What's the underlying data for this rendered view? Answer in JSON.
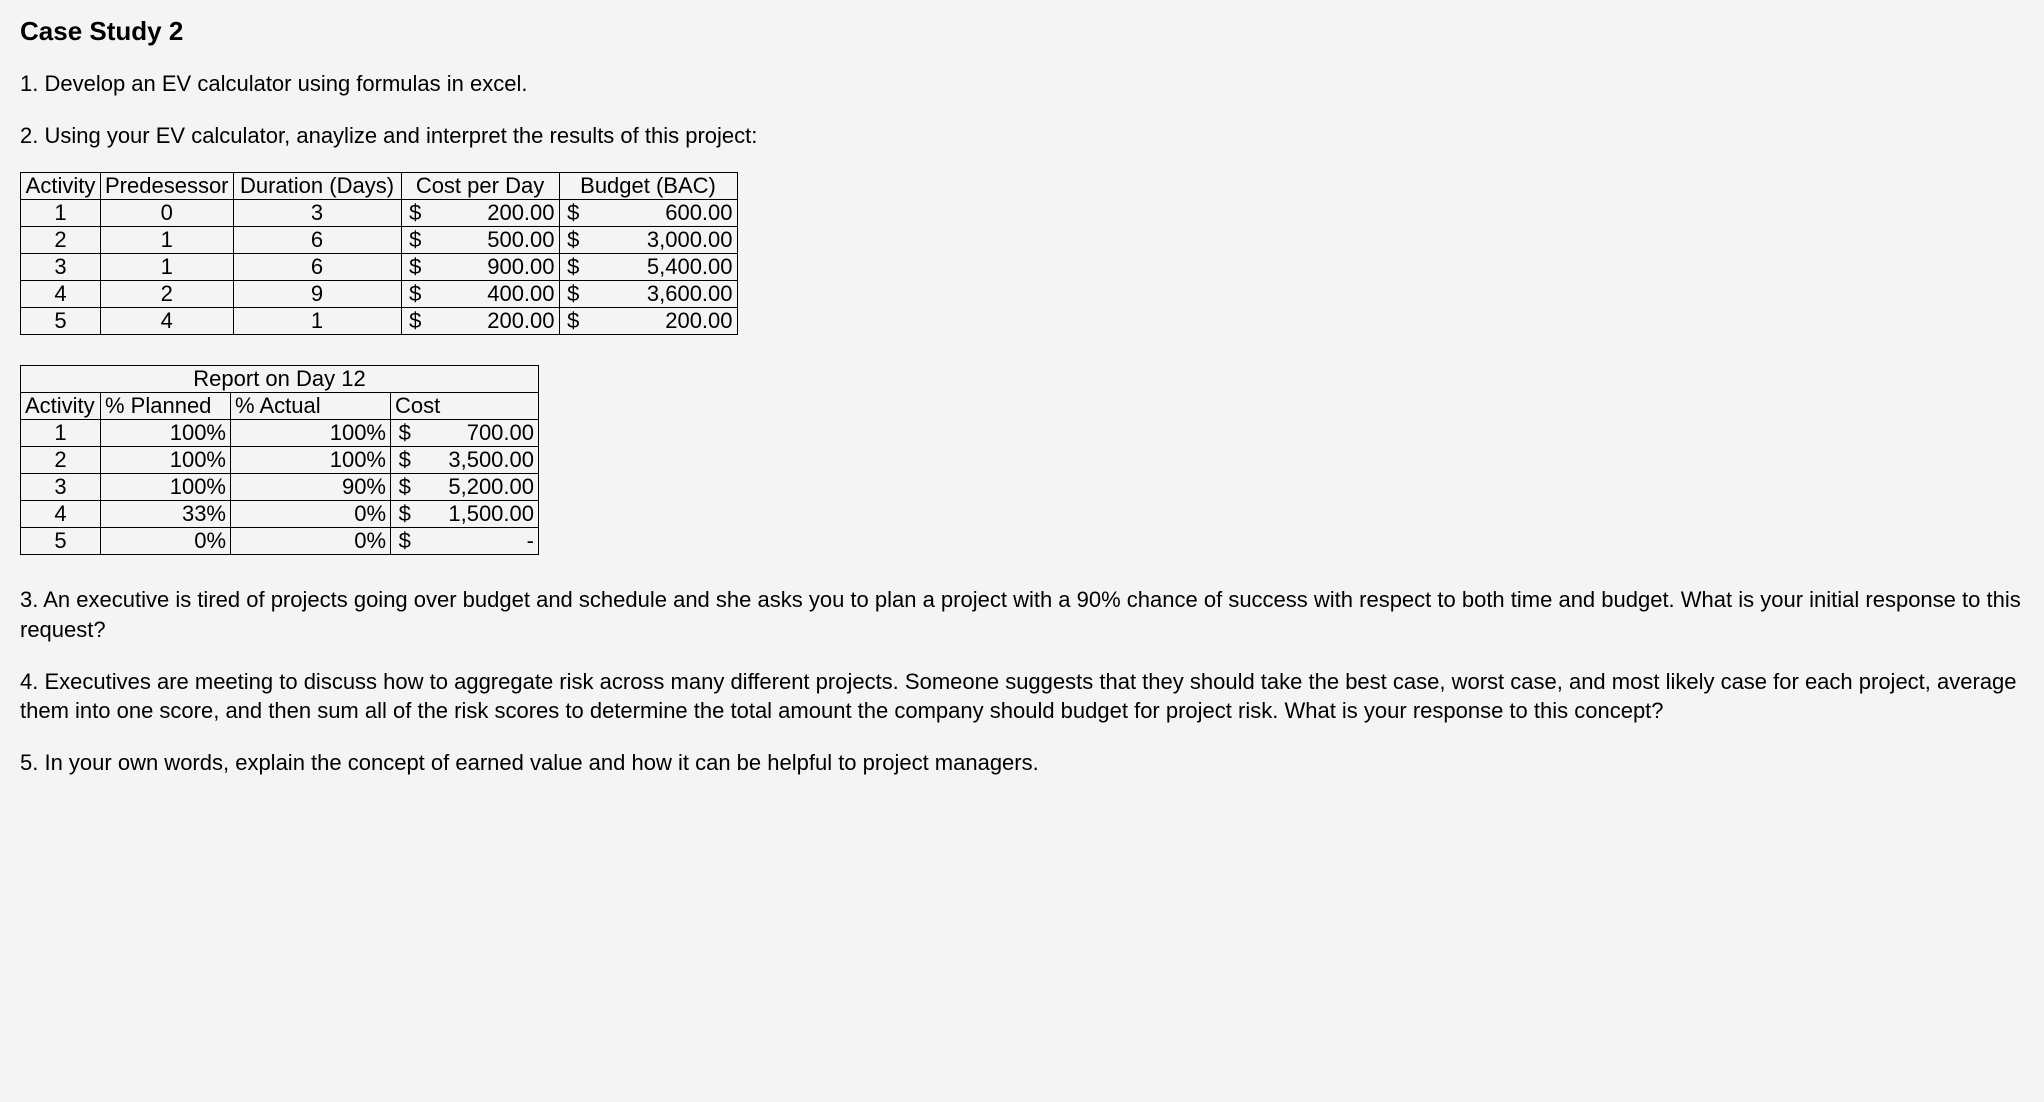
{
  "title": "Case Study 2",
  "q1": "1. Develop an EV calculator using formulas in excel.",
  "q2": "2. Using your EV calculator, anaylize and interpret the results of this project:",
  "q3": "3. An executive is tired of projects going over budget and schedule and she asks you to plan a project with a 90% chance of success with respect to both time and budget. What is your initial response to this request?",
  "q4": "4. Executives are meeting to discuss how to aggregate risk across many different projects. Someone suggests that they should take the best case, worst case, and most likely case for each project, average them into one score, and then sum all of the risk scores to determine the total amount the company should budget for project risk. What is your response to this concept?",
  "q5": "5. In your own words, explain the concept of earned value and how it can be helpful to project managers.",
  "t1": {
    "h_activity": "Activity",
    "h_pred": "Predesessor",
    "h_dur": "Duration (Days)",
    "h_cpd": "Cost per Day",
    "h_bac": "Budget (BAC)",
    "rows": [
      {
        "act": "1",
        "pred": "0",
        "dur": "3",
        "s1": "$",
        "cpd": "200.00",
        "s2": "$",
        "bac": "600.00"
      },
      {
        "act": "2",
        "pred": "1",
        "dur": "6",
        "s1": "$",
        "cpd": "500.00",
        "s2": "$",
        "bac": "3,000.00"
      },
      {
        "act": "3",
        "pred": "1",
        "dur": "6",
        "s1": "$",
        "cpd": "900.00",
        "s2": "$",
        "bac": "5,400.00"
      },
      {
        "act": "4",
        "pred": "2",
        "dur": "9",
        "s1": "$",
        "cpd": "400.00",
        "s2": "$",
        "bac": "3,600.00"
      },
      {
        "act": "5",
        "pred": "4",
        "dur": "1",
        "s1": "$",
        "cpd": "200.00",
        "s2": "$",
        "bac": "200.00"
      }
    ]
  },
  "t2": {
    "title": "Report on Day 12",
    "h_activity": "Activity",
    "h_plan": "% Planned",
    "h_act": "% Actual",
    "h_cost": "Cost",
    "rows": [
      {
        "act": "1",
        "plan": "100%",
        "actual": "100%",
        "s": "$",
        "cost": "700.00"
      },
      {
        "act": "2",
        "plan": "100%",
        "actual": "100%",
        "s": "$",
        "cost": "3,500.00"
      },
      {
        "act": "3",
        "plan": "100%",
        "actual": "90%",
        "s": "$",
        "cost": "5,200.00"
      },
      {
        "act": "4",
        "plan": "33%",
        "actual": "0%",
        "s": "$",
        "cost": "1,500.00"
      },
      {
        "act": "5",
        "plan": "0%",
        "actual": "0%",
        "s": "$",
        "cost": "-"
      }
    ]
  }
}
